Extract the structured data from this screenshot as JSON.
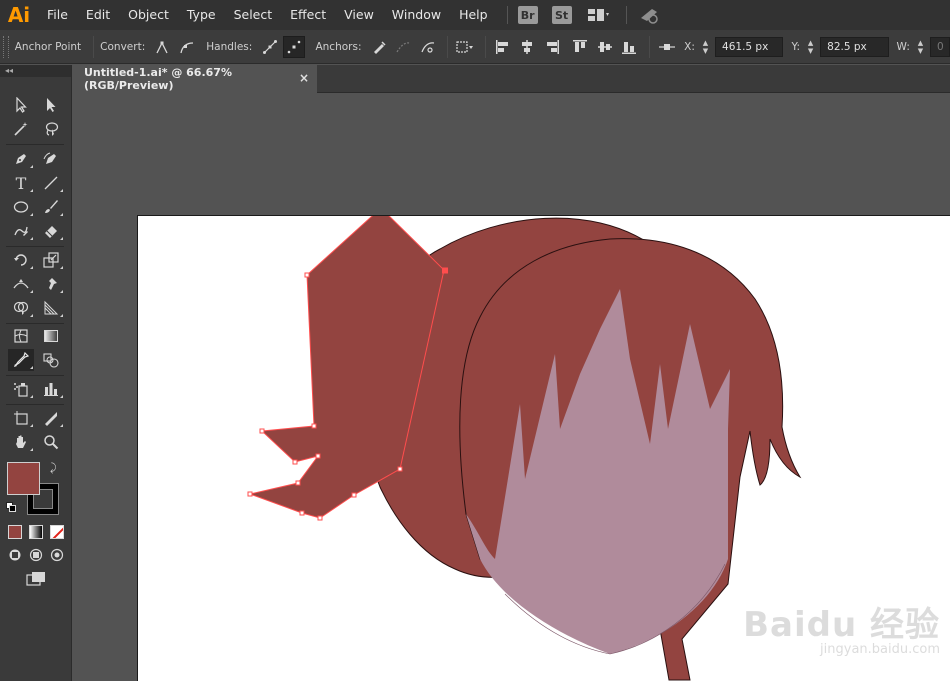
{
  "app": {
    "logo": "Ai"
  },
  "menu": [
    "File",
    "Edit",
    "Object",
    "Type",
    "Select",
    "Effect",
    "View",
    "Window",
    "Help"
  ],
  "bridge_badges": [
    "Br",
    "St"
  ],
  "control": {
    "tool_label": "Anchor Point",
    "convert_label": "Convert:",
    "handles_label": "Handles:",
    "anchors_label": "Anchors:",
    "x_label": "X:",
    "x_value": "461.5 px",
    "y_label": "Y:",
    "y_value": "82.5 px",
    "w_label": "W:",
    "w_value": "0"
  },
  "tab": {
    "title": "Untitled-1.ai* @ 66.67% (RGB/Preview)",
    "close": "×"
  },
  "tools_header": "◂◂",
  "colors": {
    "fill": "#934440",
    "hair": "#934440",
    "face": "#b08b9b",
    "selection": "#ff4d4d",
    "accent": "#ff9a00"
  },
  "watermark": {
    "brand": "Baidu 经验",
    "url": "jingyan.baidu.com"
  }
}
